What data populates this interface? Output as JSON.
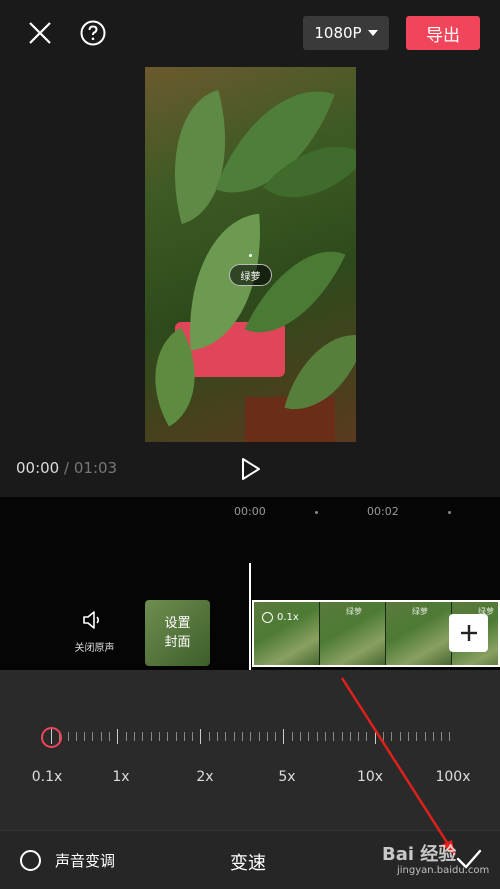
{
  "header": {
    "resolution_label": "1080P",
    "export_label": "导出"
  },
  "preview": {
    "sticker_text": "绿萝"
  },
  "playback": {
    "current_time": "00:00",
    "separator": "/",
    "total_time": "01:03"
  },
  "timeline": {
    "ruler": [
      "00:00",
      "00:02"
    ],
    "mute_label": "关闭原声",
    "cover_label_line1": "设置",
    "cover_label_line2": "封面",
    "clip_speed": "0.1x",
    "clip_frame_tag": "绿萝"
  },
  "speed": {
    "labels": [
      "0.1x",
      "1x",
      "2x",
      "5x",
      "10x",
      "100x"
    ],
    "current_value": "0.1x"
  },
  "bottom": {
    "voice_change_label": "声音变调",
    "panel_title": "变速"
  },
  "watermark": {
    "main": "Bai 经验",
    "sub": "jingyan.baidu.com"
  },
  "colors": {
    "accent": "#f0455a",
    "background": "#1a1a1a",
    "panel": "#2a2a2a"
  },
  "icons": [
    "close-icon",
    "help-icon",
    "caret-down-icon",
    "play-icon",
    "speaker-icon",
    "speed-icon",
    "plus-icon",
    "check-icon"
  ]
}
